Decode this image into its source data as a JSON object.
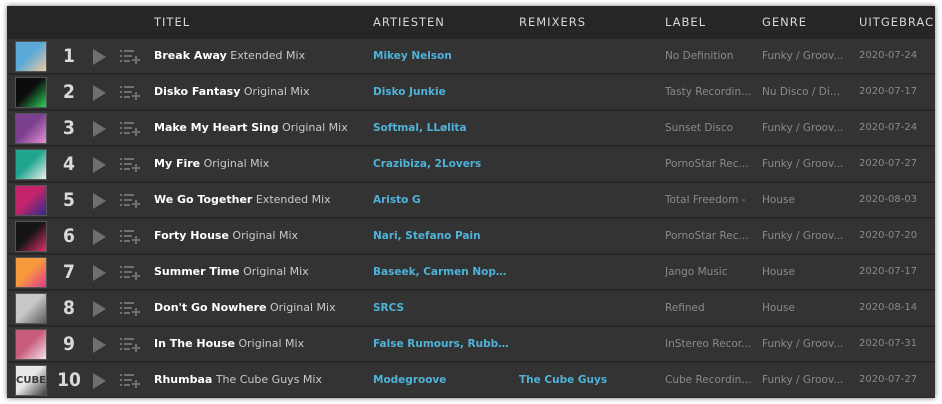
{
  "header": {
    "title": "TITEL",
    "artists": "ARTIESTEN",
    "remixers": "REMIXERS",
    "label": "LABEL",
    "genre": "GENRE",
    "released": "UITGEBRAC..."
  },
  "tracks": [
    {
      "num": "1",
      "name": "Break Away",
      "mix": "Extended Mix",
      "artists": "Mikey Nelson",
      "remixers": "",
      "label": "No Definition",
      "genre": "Funky / Groov...",
      "date": "2020-07-24",
      "art_colors": [
        "#5aa9d8",
        "#f0c9a0"
      ]
    },
    {
      "num": "2",
      "name": "Disko Fantasy",
      "mix": "Original Mix",
      "artists": "Disko Junkie",
      "remixers": "",
      "label": "Tasty Recordings",
      "genre": "Nu Disco / Disco",
      "date": "2020-07-17",
      "art_colors": [
        "#0c0c0c",
        "#2fd35a"
      ]
    },
    {
      "num": "3",
      "name": "Make My Heart Sing",
      "mix": "Original Mix",
      "artists": "Softmal, LLølita",
      "remixers": "",
      "label": "Sunset Disco",
      "genre": "Funky / Groov...",
      "date": "2020-07-24",
      "art_colors": [
        "#7a3f8f",
        "#e58fd2"
      ]
    },
    {
      "num": "4",
      "name": "My Fire",
      "mix": "Original Mix",
      "artists": "Crazibiza, 2Lovers",
      "remixers": "",
      "label": "PornoStar Rec...",
      "genre": "Funky / Groov...",
      "date": "2020-07-27",
      "art_colors": [
        "#1fa58f",
        "#f0f0f0"
      ]
    },
    {
      "num": "5",
      "name": "We Go Together",
      "mix": "Extended Mix",
      "artists": "Aristo G",
      "remixers": "",
      "label": "Total Freedom -",
      "genre": "House",
      "date": "2020-08-03",
      "art_colors": [
        "#c4246a",
        "#2b2b8f"
      ]
    },
    {
      "num": "6",
      "name": "Forty House",
      "mix": "Original Mix",
      "artists": "Nari, Stefano Pain",
      "remixers": "",
      "label": "PornoStar Rec...",
      "genre": "Funky / Groov...",
      "date": "2020-07-20",
      "art_colors": [
        "#141414",
        "#e0316e"
      ]
    },
    {
      "num": "7",
      "name": "Summer Time",
      "mix": "Original Mix",
      "artists": "Baseek, Carmen Nophra",
      "remixers": "",
      "label": "Jango Music",
      "genre": "House",
      "date": "2020-07-17",
      "art_colors": [
        "#f79a3e",
        "#e0398c"
      ]
    },
    {
      "num": "8",
      "name": "Don't Go Nowhere",
      "mix": "Original Mix",
      "artists": "SRCS",
      "remixers": "",
      "label": "Refined",
      "genre": "House",
      "date": "2020-08-14",
      "art_colors": [
        "#c8c8c8",
        "#5a5a5a"
      ]
    },
    {
      "num": "9",
      "name": "In The House",
      "mix": "Original Mix",
      "artists": "False Rumours, Rubber ...",
      "remixers": "",
      "label": "InStereo Recor...",
      "genre": "Funky / Groov...",
      "date": "2020-07-31",
      "art_colors": [
        "#c85a7a",
        "#f2e3e8"
      ]
    },
    {
      "num": "10",
      "name": "Rhumbaa",
      "mix": "The Cube Guys Mix",
      "artists": "Modegroove",
      "remixers": "The Cube Guys",
      "label": "Cube Recordings",
      "genre": "Funky / Groov...",
      "date": "2020-07-27",
      "art_colors": [
        "#e8e8e8",
        "#3a3a3a"
      ],
      "art_text": "CUBE"
    }
  ]
}
